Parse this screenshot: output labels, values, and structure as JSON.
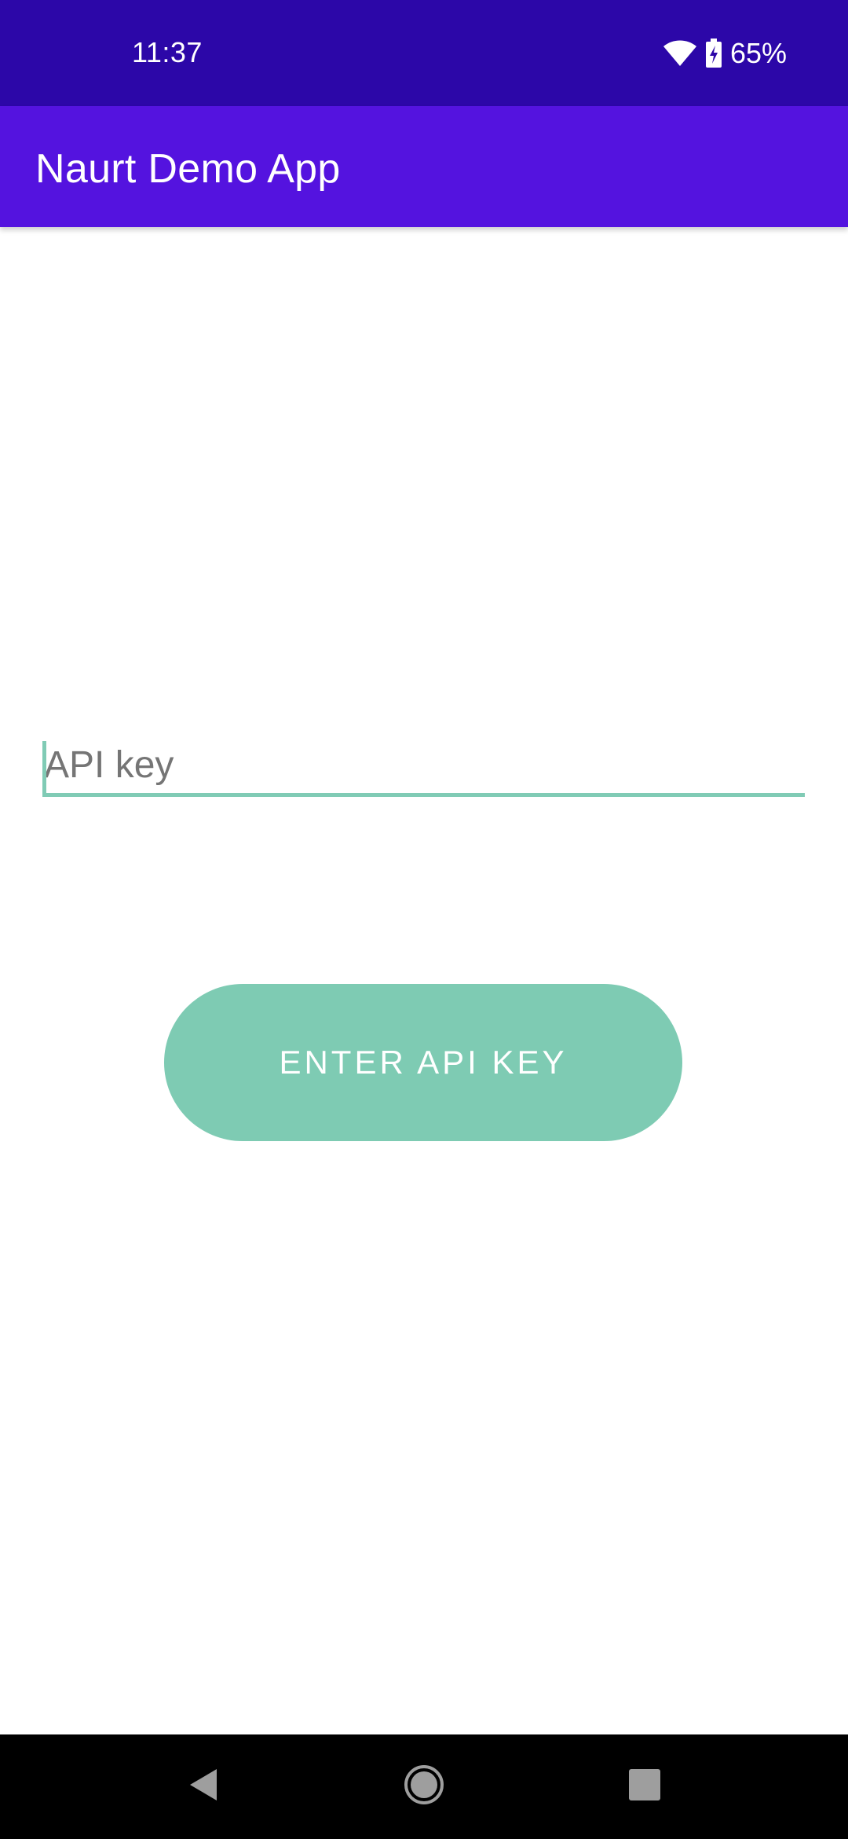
{
  "status_bar": {
    "time": "11:37",
    "battery": "65%",
    "icons": [
      "wifi-icon",
      "battery-charging-icon"
    ]
  },
  "app_bar": {
    "title": "Naurt Demo App"
  },
  "form": {
    "api_key_placeholder": "API key",
    "api_key_value": "",
    "submit_label": "ENTER API KEY"
  },
  "nav_bar": {
    "icons": [
      "back-icon",
      "home-icon",
      "recents-icon"
    ]
  },
  "colors": {
    "status_bar": "#2c07a8",
    "app_bar": "#5413df",
    "accent": "#7ecbb3",
    "nav_bar": "#000000"
  }
}
